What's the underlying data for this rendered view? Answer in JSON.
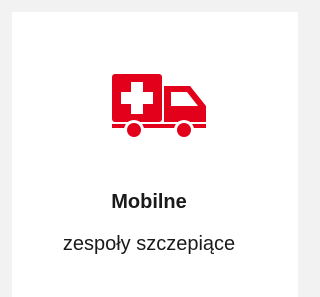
{
  "card": {
    "icon": "ambulance-icon",
    "title": "Mobilne",
    "subtitle": "zespoły szczepiące"
  },
  "colors": {
    "accent": "#e2001a",
    "background": "#f2f2f2",
    "card": "#ffffff",
    "text": "#1a1a1a"
  }
}
